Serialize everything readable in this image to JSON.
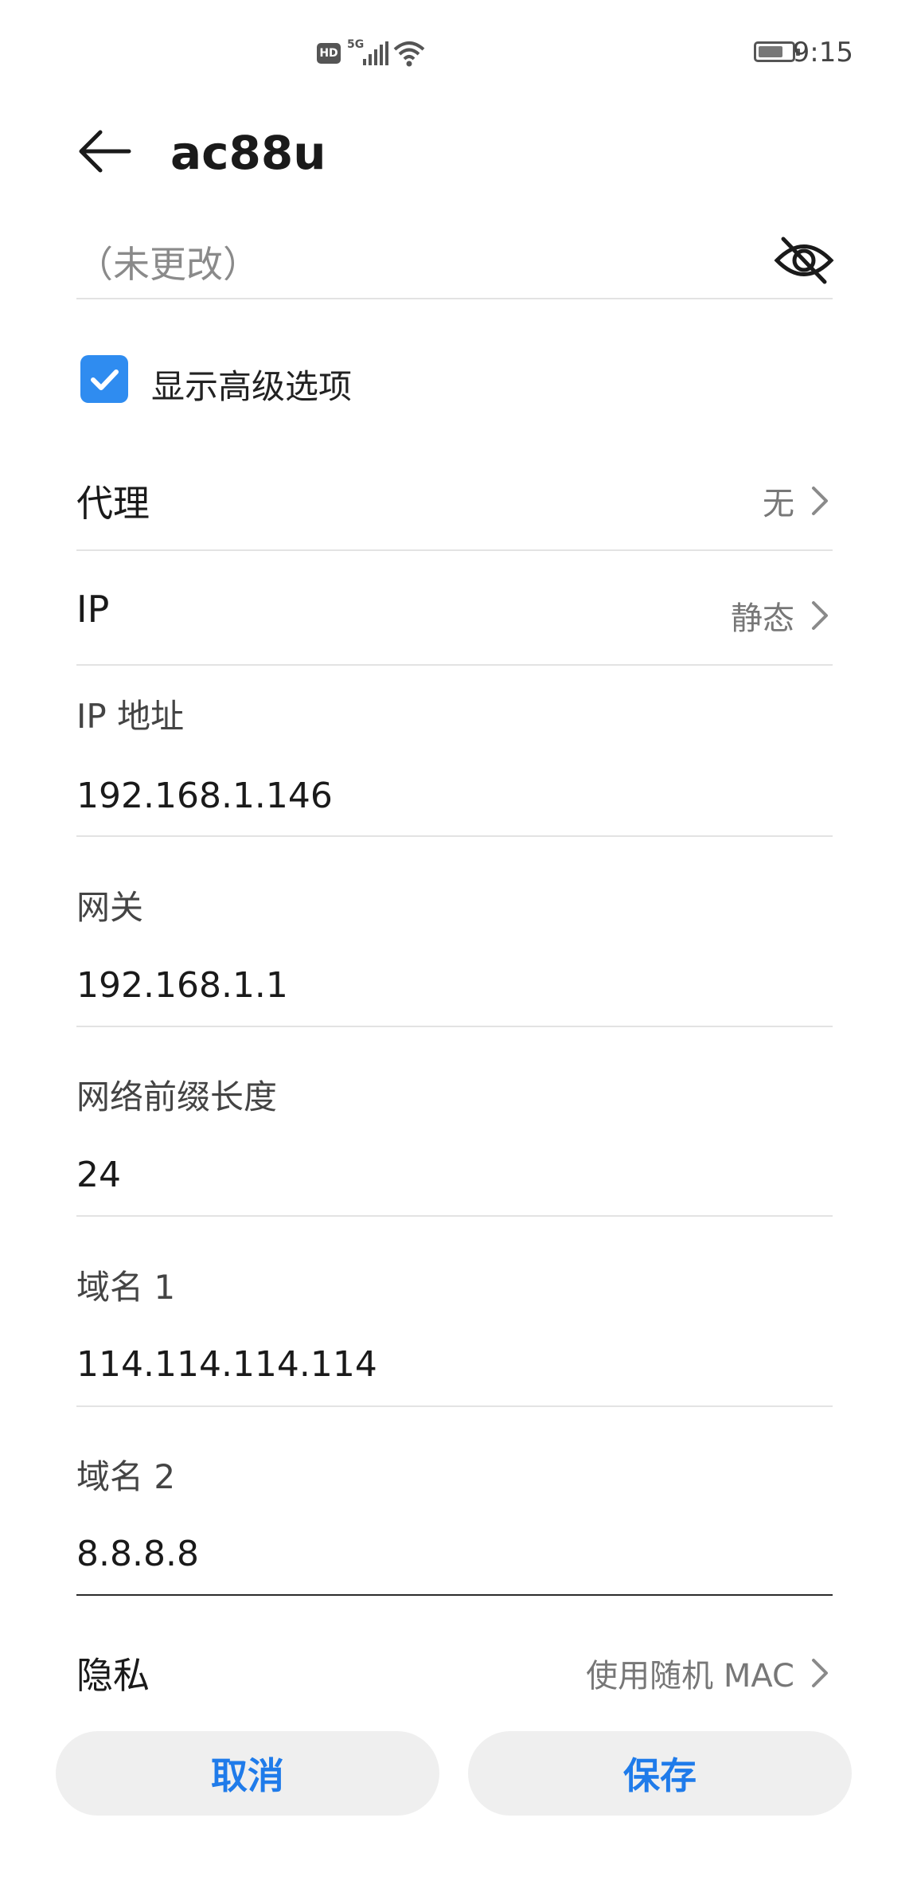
{
  "status_bar": {
    "badge": "HD",
    "network": "5G",
    "time": "9:15",
    "battery_level": 0.75,
    "icons": [
      "hd-icon",
      "signal-icon",
      "wifi-icon",
      "battery-icon"
    ]
  },
  "header": {
    "title": "ac88u",
    "back_icon": "back-arrow-icon"
  },
  "password": {
    "value": "（未更改）",
    "toggle_icon": "eye-off-icon"
  },
  "advanced": {
    "label": "显示高级选项",
    "checked": true
  },
  "proxy": {
    "label": "代理",
    "value": "无"
  },
  "ip_mode": {
    "label": "IP",
    "value": "静态"
  },
  "fields": [
    {
      "label": "IP 地址",
      "value": "192.168.1.146"
    },
    {
      "label": "网关",
      "value": "192.168.1.1"
    },
    {
      "label": "网络前缀长度",
      "value": "24"
    },
    {
      "label": "域名 1",
      "value": "114.114.114.114"
    },
    {
      "label": "域名 2",
      "value": "8.8.8.8"
    }
  ],
  "privacy": {
    "label": "隐私",
    "value": "使用随机 MAC"
  },
  "buttons": {
    "cancel": "取消",
    "save": "保存"
  },
  "colors": {
    "accent": "#1f7bea",
    "checkbox": "#2f8cf0"
  }
}
